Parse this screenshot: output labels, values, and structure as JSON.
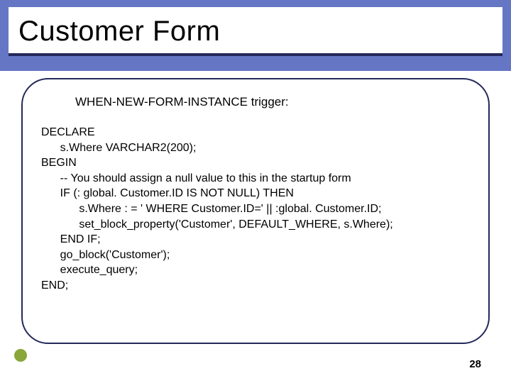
{
  "title": "Customer Form",
  "trigger_label": "WHEN-NEW-FORM-INSTANCE trigger:",
  "code": "DECLARE\n      s.Where VARCHAR2(200);\nBEGIN\n      -- You should assign a null value to this in the startup form\n      IF (: global. Customer.ID IS NOT NULL) THEN\n            s.Where : = ' WHERE Customer.ID=' || :global. Customer.ID;\n            set_block_property('Customer', DEFAULT_WHERE, s.Where);\n      END IF;\n      go_block('Customer');\n      execute_query;\nEND;",
  "page_number": "28"
}
